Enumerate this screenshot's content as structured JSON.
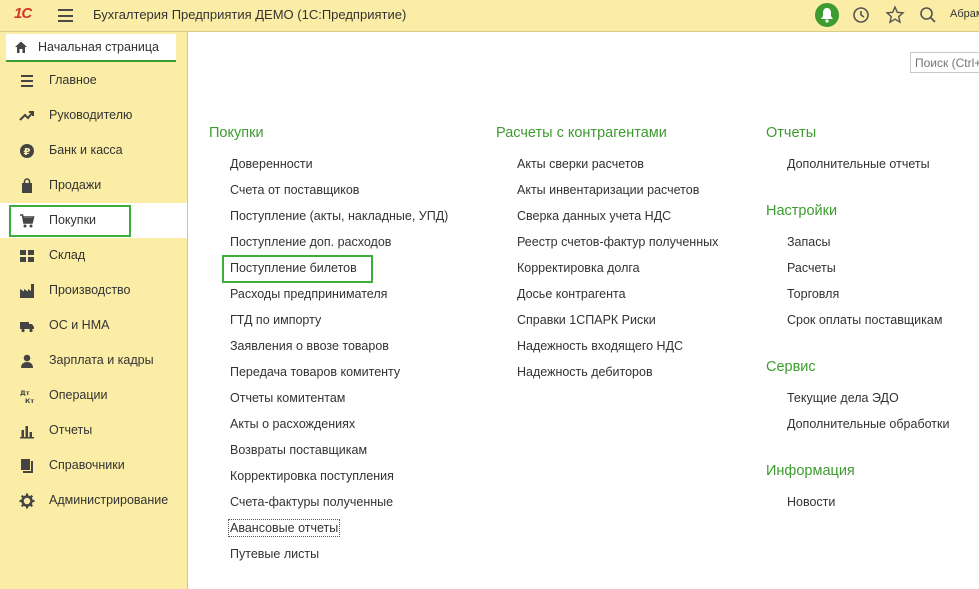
{
  "header": {
    "logo": "1С",
    "title": "Бухгалтерия Предприятия ДЕМО  (1С:Предприятие)",
    "user": "Абрамов"
  },
  "search": {
    "placeholder": "Поиск (Ctrl+F)"
  },
  "sidebar": {
    "home": "Начальная страница",
    "items": [
      {
        "label": "Главное",
        "icon": "menu-lines-icon"
      },
      {
        "label": "Руководителю",
        "icon": "trend-up-icon"
      },
      {
        "label": "Банк и касса",
        "icon": "ruble-coin-icon"
      },
      {
        "label": "Продажи",
        "icon": "shopping-bag-icon"
      },
      {
        "label": "Покупки",
        "icon": "cart-icon"
      },
      {
        "label": "Склад",
        "icon": "warehouse-icon"
      },
      {
        "label": "Производство",
        "icon": "factory-icon"
      },
      {
        "label": "ОС и НМА",
        "icon": "truck-icon"
      },
      {
        "label": "Зарплата и кадры",
        "icon": "person-icon"
      },
      {
        "label": "Операции",
        "icon": "dt-kt-icon"
      },
      {
        "label": "Отчеты",
        "icon": "bar-chart-icon"
      },
      {
        "label": "Справочники",
        "icon": "books-icon"
      },
      {
        "label": "Администрирование",
        "icon": "gear-icon"
      }
    ]
  },
  "main": {
    "col1": {
      "title": "Покупки",
      "links": [
        "Доверенности",
        "Счета от поставщиков",
        "Поступление (акты, накладные, УПД)",
        "Поступление доп. расходов",
        "Поступление билетов",
        "Расходы предпринимателя",
        "ГТД по импорту",
        "Заявления о ввозе товаров",
        "Передача товаров комитенту",
        "Отчеты комитентам",
        "Акты о расхождениях",
        "Возвраты поставщикам",
        "Корректировка поступления",
        "Счета-фактуры полученные",
        "Авансовые отчеты",
        "Путевые листы"
      ]
    },
    "col2": {
      "title": "Расчеты с контрагентами",
      "links": [
        "Акты сверки расчетов",
        "Акты инвентаризации расчетов",
        "Сверка данных учета НДС",
        "Реестр счетов-фактур полученных",
        "Корректировка долга",
        "Досье контрагента",
        "Справки 1СПАРК Риски",
        "Надежность входящего НДС",
        "Надежность дебиторов"
      ]
    },
    "col3": {
      "sections": [
        {
          "title": "Отчеты",
          "links": [
            "Дополнительные отчеты"
          ]
        },
        {
          "title": "Настройки",
          "links": [
            "Запасы",
            "Расчеты",
            "Торговля",
            "Срок оплаты поставщикам"
          ]
        },
        {
          "title": "Сервис",
          "links": [
            "Текущие дела ЭДО",
            "Дополнительные обработки"
          ]
        },
        {
          "title": "Информация",
          "links": [
            "Новости"
          ]
        }
      ]
    }
  },
  "colors": {
    "accent": "#3d9b2f",
    "sidebar_bg": "#fbeda5",
    "highlight": "#3eae3b"
  }
}
